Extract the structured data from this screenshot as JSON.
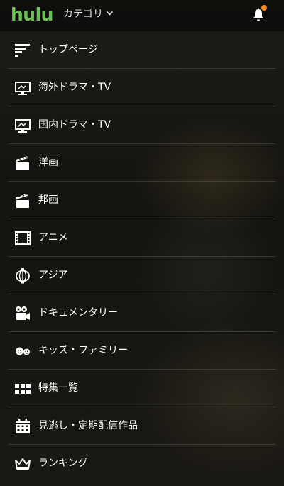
{
  "header": {
    "logo": "hulu",
    "category_label": "カテゴリ",
    "category_icon": "chevron-down-icon",
    "notification_icon": "bell-icon",
    "notification_dot_color": "#f08a1c"
  },
  "colors": {
    "brand": "#6bc153",
    "text": "#ffffff",
    "background": "#16140f"
  },
  "menu": {
    "items": [
      {
        "label": "トップページ",
        "icon": "home-lines-icon"
      },
      {
        "label": "海外ドラマ・TV",
        "icon": "monitor-icon"
      },
      {
        "label": "国内ドラマ・TV",
        "icon": "monitor-icon"
      },
      {
        "label": "洋画",
        "icon": "clapperboard-icon"
      },
      {
        "label": "邦画",
        "icon": "clapperboard-icon"
      },
      {
        "label": "アニメ",
        "icon": "film-strip-icon"
      },
      {
        "label": "アジア",
        "icon": "lantern-icon"
      },
      {
        "label": "ドキュメンタリー",
        "icon": "video-camera-icon"
      },
      {
        "label": "キッズ・ファミリー",
        "icon": "smiley-faces-icon"
      },
      {
        "label": "特集一覧",
        "icon": "grid-icon"
      },
      {
        "label": "見逃し・定期配信作品",
        "icon": "calendar-icon"
      },
      {
        "label": "ランキング",
        "icon": "crown-icon"
      }
    ]
  }
}
